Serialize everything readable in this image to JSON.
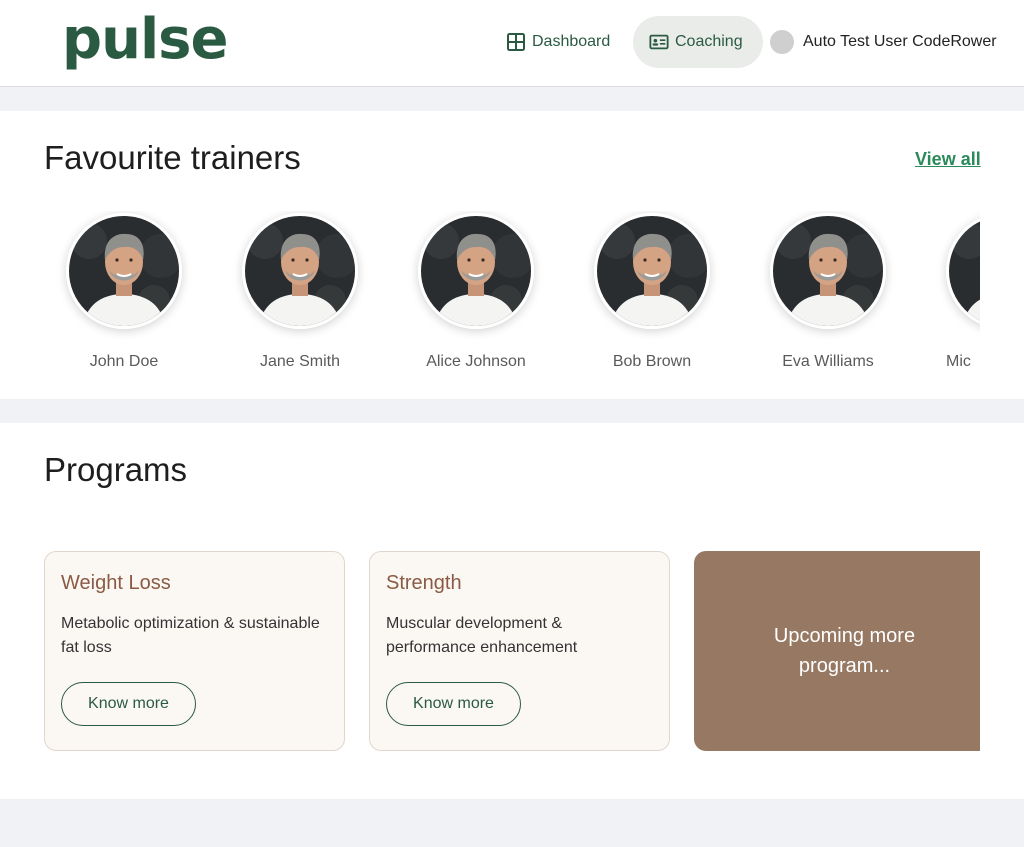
{
  "header": {
    "logo": "pulse",
    "nav": [
      {
        "label": "Dashboard",
        "icon": "grid-icon"
      },
      {
        "label": "Coaching",
        "icon": "id-card-icon",
        "active": true
      }
    ],
    "user_name": "Auto Test User CodeRower"
  },
  "trainers": {
    "title": "Favourite trainers",
    "view_all": "View all",
    "items": [
      {
        "name": "John Doe"
      },
      {
        "name": "Jane Smith"
      },
      {
        "name": "Alice Johnson"
      },
      {
        "name": "Bob Brown"
      },
      {
        "name": "Eva Williams"
      },
      {
        "name": "Mic"
      }
    ]
  },
  "programs": {
    "title": "Programs",
    "cards": [
      {
        "title": "Weight Loss",
        "description": "Metabolic optimization & sustainable fat loss",
        "button": "Know more"
      },
      {
        "title": "Strength",
        "description": "Muscular development & performance enhancement",
        "button": "Know more"
      }
    ],
    "upcoming": "Upcoming more program..."
  },
  "colors": {
    "brand_green": "#2b5a43",
    "link_green": "#2a8a5a",
    "card_title": "#8b5a44",
    "upcoming_bg": "#977963"
  }
}
